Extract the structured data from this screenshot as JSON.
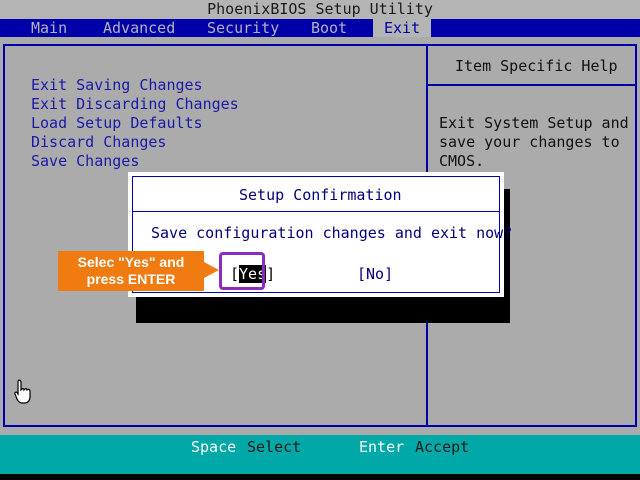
{
  "title": "PhoenixBIOS Setup Utility",
  "menu": [
    {
      "label": "Main",
      "active": false
    },
    {
      "label": "Advanced",
      "active": false
    },
    {
      "label": "Security",
      "active": false
    },
    {
      "label": "Boot",
      "active": false
    },
    {
      "label": "Exit",
      "active": true
    }
  ],
  "exit_options": [
    "Exit Saving Changes",
    "Exit Discarding Changes",
    "Load Setup Defaults",
    "Discard Changes",
    "Save Changes"
  ],
  "help": {
    "title": "Item Specific Help",
    "lines": [
      "Exit System Setup and",
      "save your changes to",
      "CMOS."
    ]
  },
  "dialog": {
    "title": "Setup Confirmation",
    "message": "Save configuration changes and exit now?",
    "yes_open": "[",
    "yes_label": "Yes",
    "yes_close": "]",
    "no_label": "[No]"
  },
  "callout": {
    "line1": "Selec \"Yes\" and",
    "line2": "press ENTER"
  },
  "status": {
    "key1": "Space",
    "action1": "Select",
    "key2": "Enter",
    "action2": "Accept"
  },
  "colors": {
    "menu_bg": "#0000aa",
    "panel_bg": "#ababab",
    "status_bg": "#00a8a8",
    "callout_bg": "#f07b10",
    "highlight": "#8a2bc2"
  },
  "icons": {
    "cursor": "hand-pointer-icon",
    "callout_arrow": "arrow-right-icon"
  }
}
